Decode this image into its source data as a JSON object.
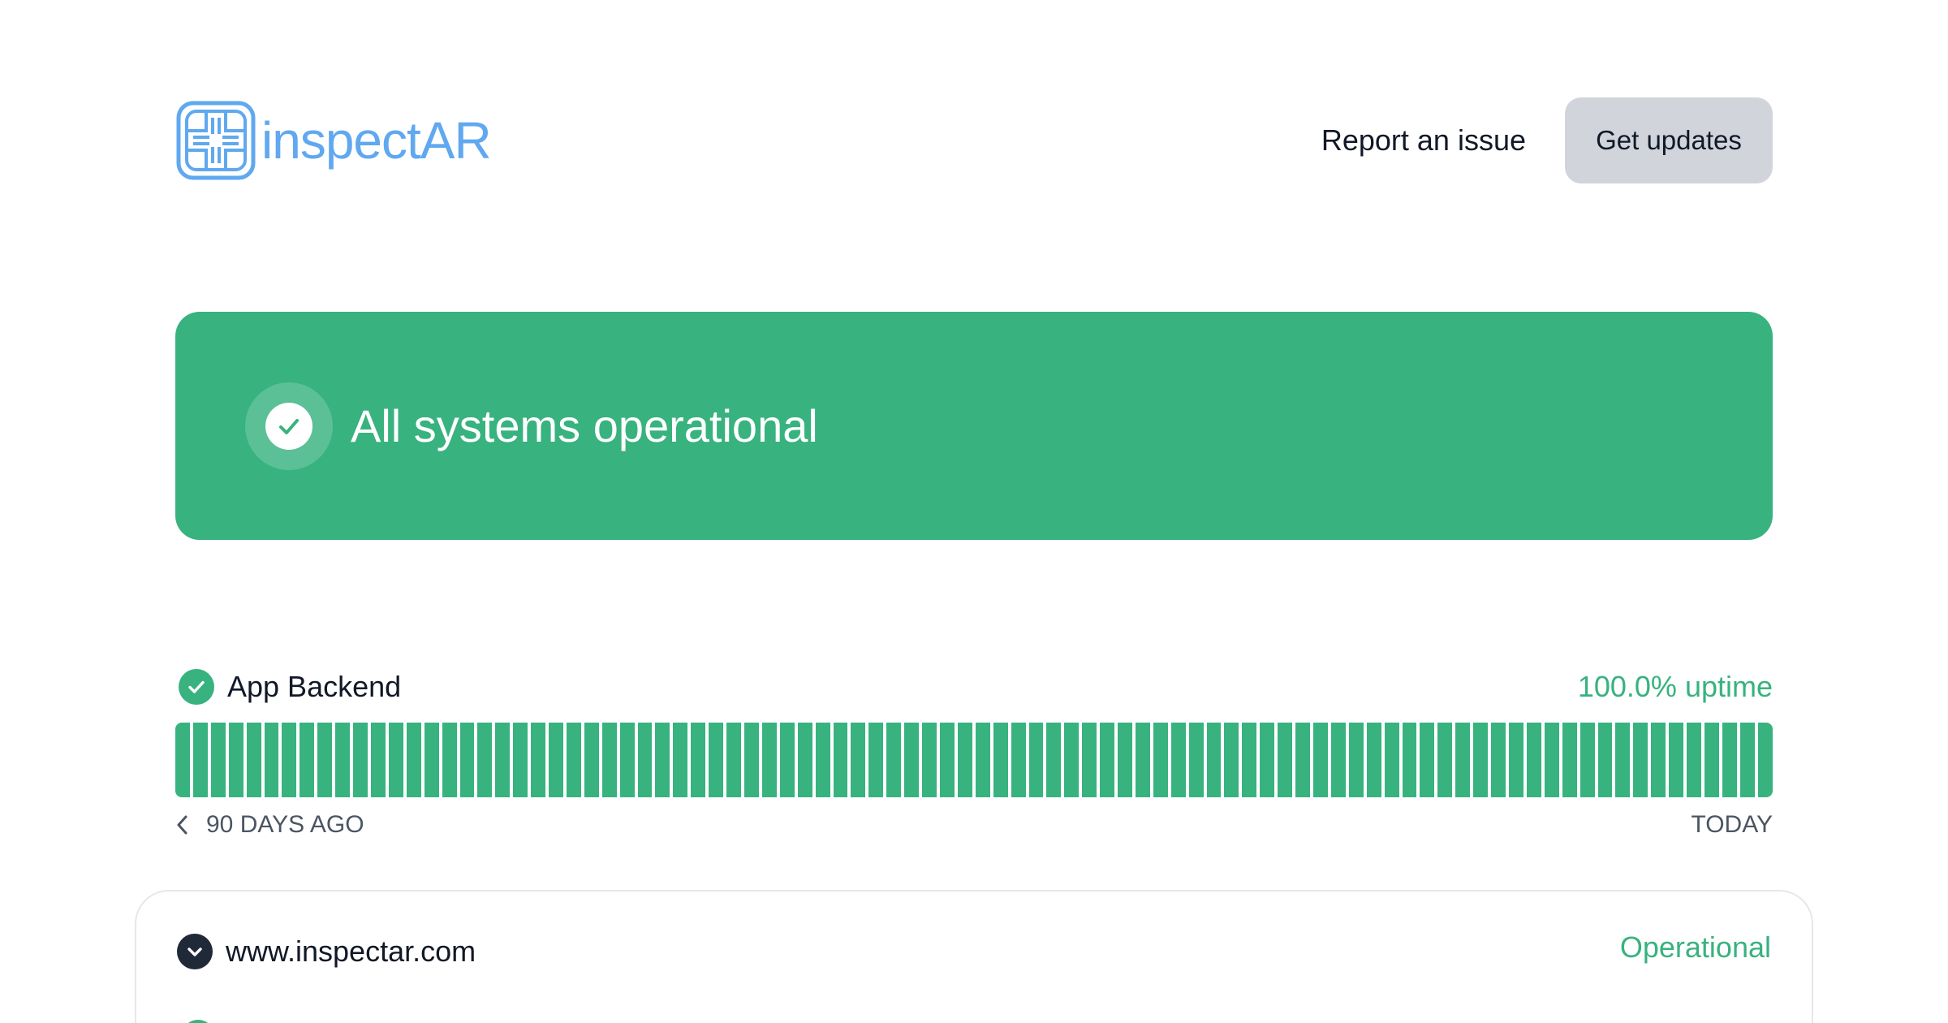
{
  "brand": {
    "logo_text": "inspectAR",
    "logo_color": "#60a8f0"
  },
  "header": {
    "report_label": "Report an issue",
    "updates_label": "Get updates"
  },
  "status_banner": {
    "text": "All systems operational",
    "color": "#38b27f",
    "icon": "check-circle-icon"
  },
  "components": [
    {
      "name": "App Backend",
      "uptime": "100.0% uptime",
      "status_icon": "check-circle-icon",
      "history_days": 90,
      "day_status": "operational",
      "range_start": "90 DAYS AGO",
      "range_end": "TODAY"
    }
  ],
  "groups": [
    {
      "name": "www.inspectar.com",
      "status": "Operational",
      "toggle_icon": "chevron-down-icon"
    }
  ],
  "colors": {
    "operational": "#38b27f",
    "button_bg": "#d1d5db",
    "text": "#111827",
    "muted": "#4b5563"
  }
}
